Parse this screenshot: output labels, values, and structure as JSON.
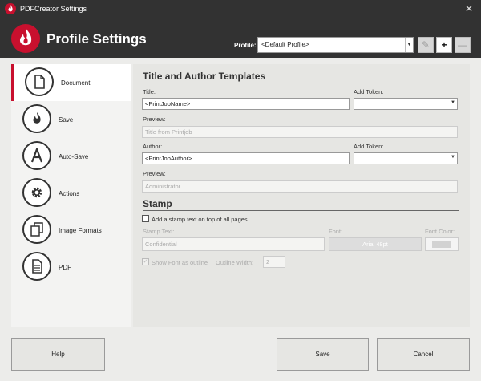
{
  "window": {
    "title": "PDFCreator Settings",
    "close_glyph": "✕"
  },
  "header": {
    "heading": "Profile Settings",
    "profile_label": "Profile:",
    "profile_value": "<Default Profile>",
    "buttons": {
      "rename": "✎",
      "add": "+",
      "remove": "—"
    }
  },
  "sidebar": {
    "items": [
      {
        "label": "Document",
        "icon": "document-icon",
        "selected": true
      },
      {
        "label": "Save",
        "icon": "flame-icon"
      },
      {
        "label": "Auto-Save",
        "icon": "letter-a-icon"
      },
      {
        "label": "Actions",
        "icon": "gear-icon"
      },
      {
        "label": "Image Formats",
        "icon": "stacked-pages-icon"
      },
      {
        "label": "PDF",
        "icon": "pdf-document-icon"
      }
    ]
  },
  "content": {
    "templates_title": "Title and Author Templates",
    "title_label": "Title:",
    "title_value": "<PrintJobName>",
    "add_token_label": "Add Token:",
    "title_preview_label": "Preview:",
    "title_preview_value": "Title from Printjob",
    "author_label": "Author:",
    "author_value": "<PrintJobAuthor>",
    "add_token_label_2": "Add Token:",
    "author_preview_label": "Preview:",
    "author_preview_value": "Administrator",
    "stamp_title": "Stamp",
    "stamp_checkbox_label": "Add a stamp text on top of all pages",
    "stamp_checked": false,
    "stamp_text_label": "Stamp Text:",
    "stamp_text_value": "Confidential",
    "font_label": "Font:",
    "font_button": "Arial 48pt",
    "font_color_label": "Font Color:",
    "outline_checkbox_label": "Show Font as outline",
    "outline_checked": true,
    "outline_width_label": "Outline Width:",
    "outline_width_value": "2"
  },
  "footer": {
    "help": "Help",
    "save": "Save",
    "cancel": "Cancel"
  },
  "colors": {
    "accent": "#c8102e",
    "titlebar": "#323232",
    "panel": "#e6e6e3"
  }
}
